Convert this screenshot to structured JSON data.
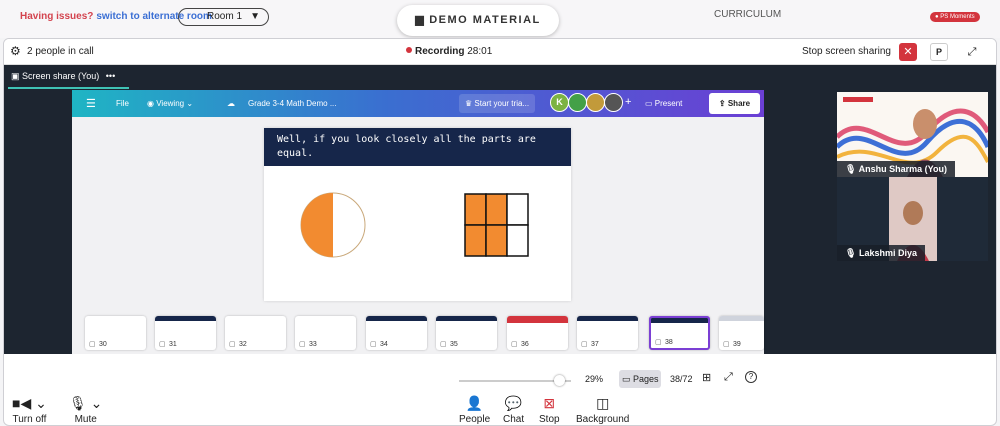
{
  "topbar": {
    "issue_prefix": "Having issues?",
    "issue_link": "switch to alternate room",
    "room": "Room 1",
    "demo_label": "DEMO MATERIAL",
    "curriculum": "CURRICULUM",
    "ps_moments": "PS Moments"
  },
  "call": {
    "people": "2 people in call",
    "recording_label": "Recording",
    "recording_time": "28:01",
    "stop_share": "Stop screen sharing",
    "p_label": "P",
    "tab": "Screen share (You)"
  },
  "canva": {
    "file": "File",
    "viewing": "Viewing",
    "doc_title": "Grade 3-4 Math Demo ...",
    "trial": "Start your tria...",
    "avatar_k": "K",
    "present": "Present",
    "share": "Share",
    "slide_text": "Well, if you look closely all the parts are equal.",
    "zoom": "29%",
    "pages": "Pages",
    "page_num": "38/72",
    "thumbs": [
      "30",
      "31",
      "32",
      "33",
      "34",
      "35",
      "36",
      "37",
      "38",
      "39"
    ]
  },
  "videos": {
    "v1_name": "Anshu Sharma (You)",
    "v2_name": "Lakshmi Diya"
  },
  "bottom": {
    "turn_off": "Turn off",
    "mute": "Mute",
    "people": "People",
    "chat": "Chat",
    "stop": "Stop",
    "background": "Background"
  },
  "colors": {
    "accent": "#d3343d",
    "brand_teal": "#3fc3b5",
    "fraction_orange": "#f28b30"
  }
}
